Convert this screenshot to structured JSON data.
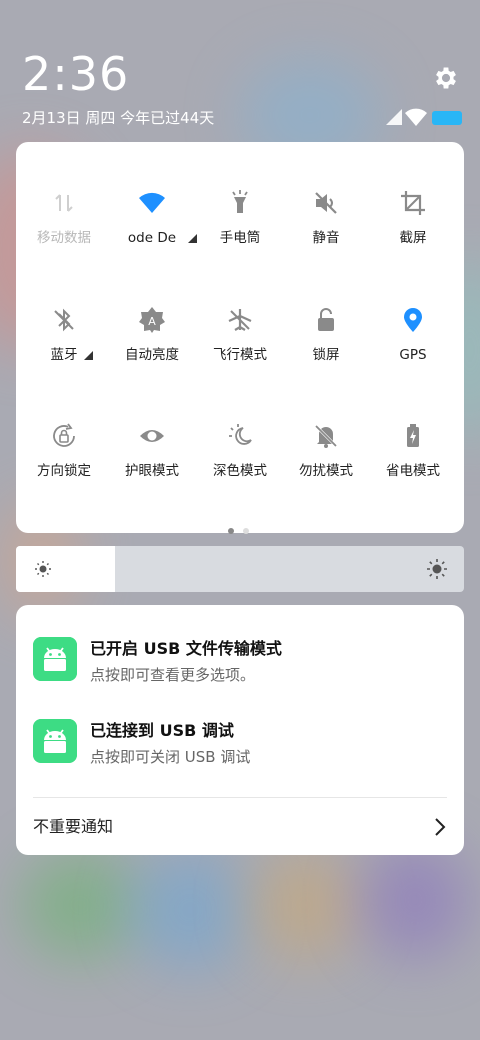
{
  "status": {
    "time": "2:36",
    "date": "2月13日 周四 今年已过44天",
    "icons": [
      "settings-gear",
      "signal",
      "wifi",
      "battery"
    ],
    "battery_color": "#29b6f6"
  },
  "quick_settings": {
    "tiles": [
      {
        "name": "mobile-data",
        "label": "移动数据",
        "icon": "arrows-updown-icon",
        "state": "disabled"
      },
      {
        "name": "wifi",
        "label": "ode   De",
        "icon": "wifi-icon",
        "state": "on"
      },
      {
        "name": "flashlight",
        "label": "手电筒",
        "icon": "flashlight-icon",
        "state": "off"
      },
      {
        "name": "silent",
        "label": "静音",
        "icon": "speaker-muted-icon",
        "state": "off"
      },
      {
        "name": "screenshot",
        "label": "截屏",
        "icon": "crop-icon",
        "state": "off"
      },
      {
        "name": "bluetooth",
        "label": "蓝牙",
        "icon": "bluetooth-off-icon",
        "state": "off"
      },
      {
        "name": "auto-brightness",
        "label": "自动亮度",
        "icon": "auto-brightness-icon",
        "state": "off"
      },
      {
        "name": "airplane",
        "label": "飞行模式",
        "icon": "airplane-off-icon",
        "state": "off"
      },
      {
        "name": "lock-screen",
        "label": "锁屏",
        "icon": "lock-icon",
        "state": "off"
      },
      {
        "name": "gps",
        "label": "GPS",
        "icon": "location-pin-icon",
        "state": "on"
      },
      {
        "name": "rotation-lock",
        "label": "方向锁定",
        "icon": "rotation-lock-icon",
        "state": "off"
      },
      {
        "name": "eye-comfort",
        "label": "护眼模式",
        "icon": "eye-icon",
        "state": "off"
      },
      {
        "name": "dark-mode",
        "label": "深色模式",
        "icon": "dark-mode-icon",
        "state": "off"
      },
      {
        "name": "do-not-disturb",
        "label": "勿扰模式",
        "icon": "bell-off-icon",
        "state": "off"
      },
      {
        "name": "battery-saver",
        "label": "省电模式",
        "icon": "battery-saver-icon",
        "state": "off"
      }
    ],
    "active_color": "#1e90ff",
    "page_count": 2,
    "current_page": 1
  },
  "brightness": {
    "level": 0.22
  },
  "notifications": {
    "items": [
      {
        "title": "已开启 USB 文件传输模式",
        "text": "点按即可查看更多选项。"
      },
      {
        "title": "已连接到 USB 调试",
        "text": "点按即可关闭 USB 调试"
      }
    ],
    "unimportant_label": "不重要通知"
  }
}
